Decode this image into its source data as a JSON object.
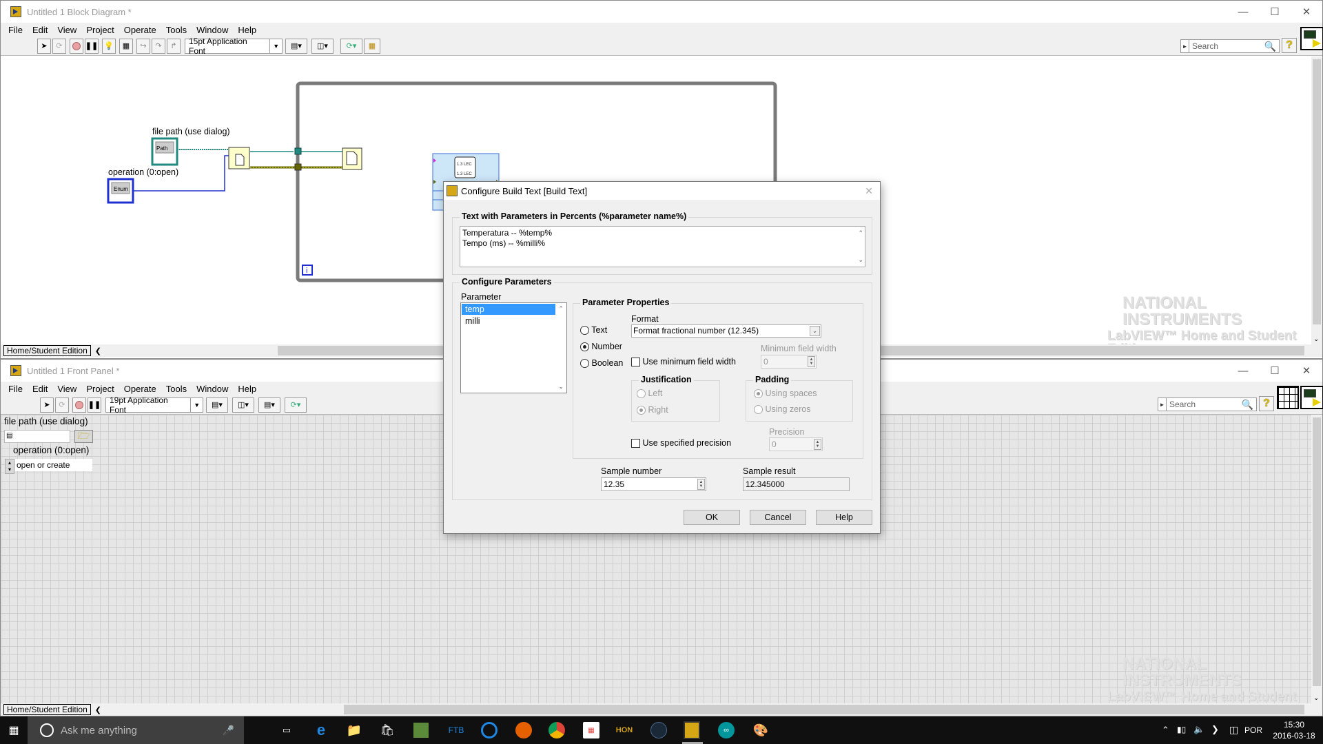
{
  "block_diagram": {
    "title": "Untitled 1 Block Diagram *",
    "menu": [
      "File",
      "Edit",
      "View",
      "Project",
      "Operate",
      "Tools",
      "Window",
      "Help"
    ],
    "font_selector": "15pt Application Font",
    "search_placeholder": "Search",
    "help_icon": "?",
    "context": "Home/Student Edition",
    "nodes": {
      "file_path_label": "file path (use dialog)",
      "file_path_terminal": "Path",
      "operation_label": "operation (0:open)",
      "operation_terminal": "Enum",
      "loop_iteration": "i",
      "build_text_icon_top": "1.3 LEC",
      "build_text_icon_bottom": "1.3 LEC"
    },
    "watermark": {
      "line1": "NATIONAL",
      "line2": "INSTRUMENTS",
      "line3": "LabVIEW™ Home and Student Edition"
    }
  },
  "front_panel": {
    "title": "Untitled 1 Front Panel *",
    "menu": [
      "File",
      "Edit",
      "View",
      "Project",
      "Operate",
      "Tools",
      "Window",
      "Help"
    ],
    "font_selector": "19pt Application Font",
    "search_placeholder": "Search",
    "help_icon": "?",
    "context": "Home/Student Edition",
    "controls": {
      "file_path_label": "file path (use dialog)",
      "file_path_value": "",
      "operation_label": "operation (0:open)",
      "operation_value": "open or create"
    },
    "watermark": {
      "line1": "NATIONAL",
      "line2": "INSTRUMENTS",
      "line3": "LabVIEW™ Home and Student Edition"
    }
  },
  "dialog": {
    "title": "Configure Build Text [Build Text]",
    "text_group_label": "Text with Parameters in Percents (%parameter name%)",
    "text_lines": [
      "Temperatura -- %temp%",
      "Tempo (ms) -- %milli%"
    ],
    "configure_group_label": "Configure Parameters",
    "parameter_label": "Parameter",
    "parameters": [
      {
        "name": "temp",
        "selected": true
      },
      {
        "name": "milli",
        "selected": false
      }
    ],
    "properties_label": "Parameter Properties",
    "type_options": [
      {
        "label": "Text",
        "selected": false
      },
      {
        "label": "Number",
        "selected": true
      },
      {
        "label": "Boolean",
        "selected": false
      }
    ],
    "format_label": "Format",
    "format_value": "Format fractional number  (12.345)",
    "use_min_width_label": "Use minimum field width",
    "use_min_width_checked": false,
    "min_width_label": "Minimum field width",
    "min_width_value": "0",
    "justification_label": "Justification",
    "justification_options": [
      {
        "label": "Left",
        "selected": false
      },
      {
        "label": "Right",
        "selected": true
      }
    ],
    "padding_label": "Padding",
    "padding_options": [
      {
        "label": "Using spaces",
        "selected": true
      },
      {
        "label": "Using zeros",
        "selected": false
      }
    ],
    "use_precision_label": "Use specified precision",
    "use_precision_checked": false,
    "precision_label": "Precision",
    "precision_value": "0",
    "sample_number_label": "Sample number",
    "sample_number_value": "12.35",
    "sample_result_label": "Sample result",
    "sample_result_value": "12.345000",
    "ok_label": "OK",
    "cancel_label": "Cancel",
    "help_label": "Help"
  },
  "taskbar": {
    "search_placeholder": "Ask me anything",
    "apps": [
      "task-view",
      "edge",
      "file-explorer",
      "store",
      "minecraft",
      "ftb",
      "app-circle",
      "firefox",
      "chrome",
      "app-grid",
      "hon",
      "steam",
      "labview",
      "arduino",
      "paint"
    ],
    "language": "POR",
    "time": "15:30",
    "date": "2016-03-18"
  }
}
